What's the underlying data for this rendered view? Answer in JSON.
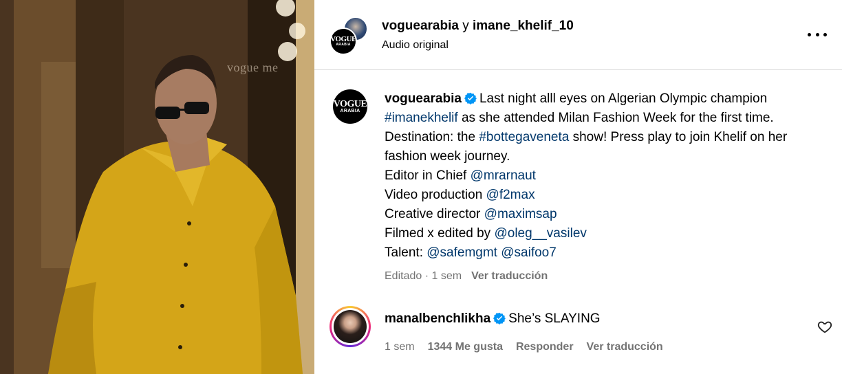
{
  "media": {
    "watermark": "vogue me"
  },
  "header": {
    "account_primary": "voguearabia",
    "joiner": " y ",
    "account_secondary": "imane_khelif_10",
    "audio": "Audio original",
    "logo_main": "VOGUE",
    "logo_sub": "ARABIA",
    "more_icon": "more-horizontal-icon"
  },
  "caption": {
    "logo_main": "VOGUE",
    "logo_sub": "ARABIA",
    "username": "voguearabia",
    "verified_color": "#0095f6",
    "text_1": "Last night alll eyes on Algerian Olympic champion ",
    "hashtag_1": "#imanekhelif",
    "text_2": " as she attended Milan Fashion Week for the first time. Destination: the ",
    "hashtag_2": "#bottegaveneta",
    "text_3": " show! Press play to join Khelif on her fashion week journey.",
    "credits": [
      {
        "label": "Editor in Chief ",
        "handle": "@mrarnaut"
      },
      {
        "label": "Video production ",
        "handle": "@f2max"
      },
      {
        "label": "Creative director ",
        "handle": "@maximsap"
      },
      {
        "label": "Filmed x edited by ",
        "handle": "@oleg__vasilev"
      },
      {
        "label": "Talent: ",
        "handle": "@safemgmt",
        "handle2": "@saifoo7"
      }
    ],
    "meta_status": "Editado · 1 sem",
    "meta_translate": "Ver traducción"
  },
  "comment": {
    "username": "manalbenchlikha",
    "text": "She’s SLAYING",
    "time": "1 sem",
    "likes": "1344 Me gusta",
    "reply": "Responder",
    "translate": "Ver traducción",
    "like_icon": "heart-icon"
  },
  "colors": {
    "link": "#00376b",
    "muted": "#737373",
    "divider": "#dbdbdb",
    "verified": "#0095f6"
  }
}
